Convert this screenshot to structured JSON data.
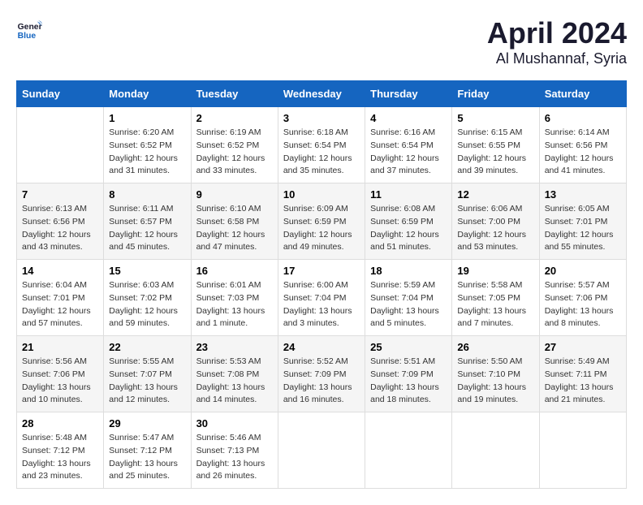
{
  "header": {
    "logo_general": "General",
    "logo_blue": "Blue",
    "title": "April 2024",
    "subtitle": "Al Mushannaf, Syria"
  },
  "calendar": {
    "days_of_week": [
      "Sunday",
      "Monday",
      "Tuesday",
      "Wednesday",
      "Thursday",
      "Friday",
      "Saturday"
    ],
    "weeks": [
      [
        {
          "day": "",
          "info": ""
        },
        {
          "day": "1",
          "info": "Sunrise: 6:20 AM\nSunset: 6:52 PM\nDaylight: 12 hours\nand 31 minutes."
        },
        {
          "day": "2",
          "info": "Sunrise: 6:19 AM\nSunset: 6:52 PM\nDaylight: 12 hours\nand 33 minutes."
        },
        {
          "day": "3",
          "info": "Sunrise: 6:18 AM\nSunset: 6:54 PM\nDaylight: 12 hours\nand 35 minutes."
        },
        {
          "day": "4",
          "info": "Sunrise: 6:16 AM\nSunset: 6:54 PM\nDaylight: 12 hours\nand 37 minutes."
        },
        {
          "day": "5",
          "info": "Sunrise: 6:15 AM\nSunset: 6:55 PM\nDaylight: 12 hours\nand 39 minutes."
        },
        {
          "day": "6",
          "info": "Sunrise: 6:14 AM\nSunset: 6:56 PM\nDaylight: 12 hours\nand 41 minutes."
        }
      ],
      [
        {
          "day": "7",
          "info": "Sunrise: 6:13 AM\nSunset: 6:56 PM\nDaylight: 12 hours\nand 43 minutes."
        },
        {
          "day": "8",
          "info": "Sunrise: 6:11 AM\nSunset: 6:57 PM\nDaylight: 12 hours\nand 45 minutes."
        },
        {
          "day": "9",
          "info": "Sunrise: 6:10 AM\nSunset: 6:58 PM\nDaylight: 12 hours\nand 47 minutes."
        },
        {
          "day": "10",
          "info": "Sunrise: 6:09 AM\nSunset: 6:59 PM\nDaylight: 12 hours\nand 49 minutes."
        },
        {
          "day": "11",
          "info": "Sunrise: 6:08 AM\nSunset: 6:59 PM\nDaylight: 12 hours\nand 51 minutes."
        },
        {
          "day": "12",
          "info": "Sunrise: 6:06 AM\nSunset: 7:00 PM\nDaylight: 12 hours\nand 53 minutes."
        },
        {
          "day": "13",
          "info": "Sunrise: 6:05 AM\nSunset: 7:01 PM\nDaylight: 12 hours\nand 55 minutes."
        }
      ],
      [
        {
          "day": "14",
          "info": "Sunrise: 6:04 AM\nSunset: 7:01 PM\nDaylight: 12 hours\nand 57 minutes."
        },
        {
          "day": "15",
          "info": "Sunrise: 6:03 AM\nSunset: 7:02 PM\nDaylight: 12 hours\nand 59 minutes."
        },
        {
          "day": "16",
          "info": "Sunrise: 6:01 AM\nSunset: 7:03 PM\nDaylight: 13 hours\nand 1 minute."
        },
        {
          "day": "17",
          "info": "Sunrise: 6:00 AM\nSunset: 7:04 PM\nDaylight: 13 hours\nand 3 minutes."
        },
        {
          "day": "18",
          "info": "Sunrise: 5:59 AM\nSunset: 7:04 PM\nDaylight: 13 hours\nand 5 minutes."
        },
        {
          "day": "19",
          "info": "Sunrise: 5:58 AM\nSunset: 7:05 PM\nDaylight: 13 hours\nand 7 minutes."
        },
        {
          "day": "20",
          "info": "Sunrise: 5:57 AM\nSunset: 7:06 PM\nDaylight: 13 hours\nand 8 minutes."
        }
      ],
      [
        {
          "day": "21",
          "info": "Sunrise: 5:56 AM\nSunset: 7:06 PM\nDaylight: 13 hours\nand 10 minutes."
        },
        {
          "day": "22",
          "info": "Sunrise: 5:55 AM\nSunset: 7:07 PM\nDaylight: 13 hours\nand 12 minutes."
        },
        {
          "day": "23",
          "info": "Sunrise: 5:53 AM\nSunset: 7:08 PM\nDaylight: 13 hours\nand 14 minutes."
        },
        {
          "day": "24",
          "info": "Sunrise: 5:52 AM\nSunset: 7:09 PM\nDaylight: 13 hours\nand 16 minutes."
        },
        {
          "day": "25",
          "info": "Sunrise: 5:51 AM\nSunset: 7:09 PM\nDaylight: 13 hours\nand 18 minutes."
        },
        {
          "day": "26",
          "info": "Sunrise: 5:50 AM\nSunset: 7:10 PM\nDaylight: 13 hours\nand 19 minutes."
        },
        {
          "day": "27",
          "info": "Sunrise: 5:49 AM\nSunset: 7:11 PM\nDaylight: 13 hours\nand 21 minutes."
        }
      ],
      [
        {
          "day": "28",
          "info": "Sunrise: 5:48 AM\nSunset: 7:12 PM\nDaylight: 13 hours\nand 23 minutes."
        },
        {
          "day": "29",
          "info": "Sunrise: 5:47 AM\nSunset: 7:12 PM\nDaylight: 13 hours\nand 25 minutes."
        },
        {
          "day": "30",
          "info": "Sunrise: 5:46 AM\nSunset: 7:13 PM\nDaylight: 13 hours\nand 26 minutes."
        },
        {
          "day": "",
          "info": ""
        },
        {
          "day": "",
          "info": ""
        },
        {
          "day": "",
          "info": ""
        },
        {
          "day": "",
          "info": ""
        }
      ]
    ]
  }
}
